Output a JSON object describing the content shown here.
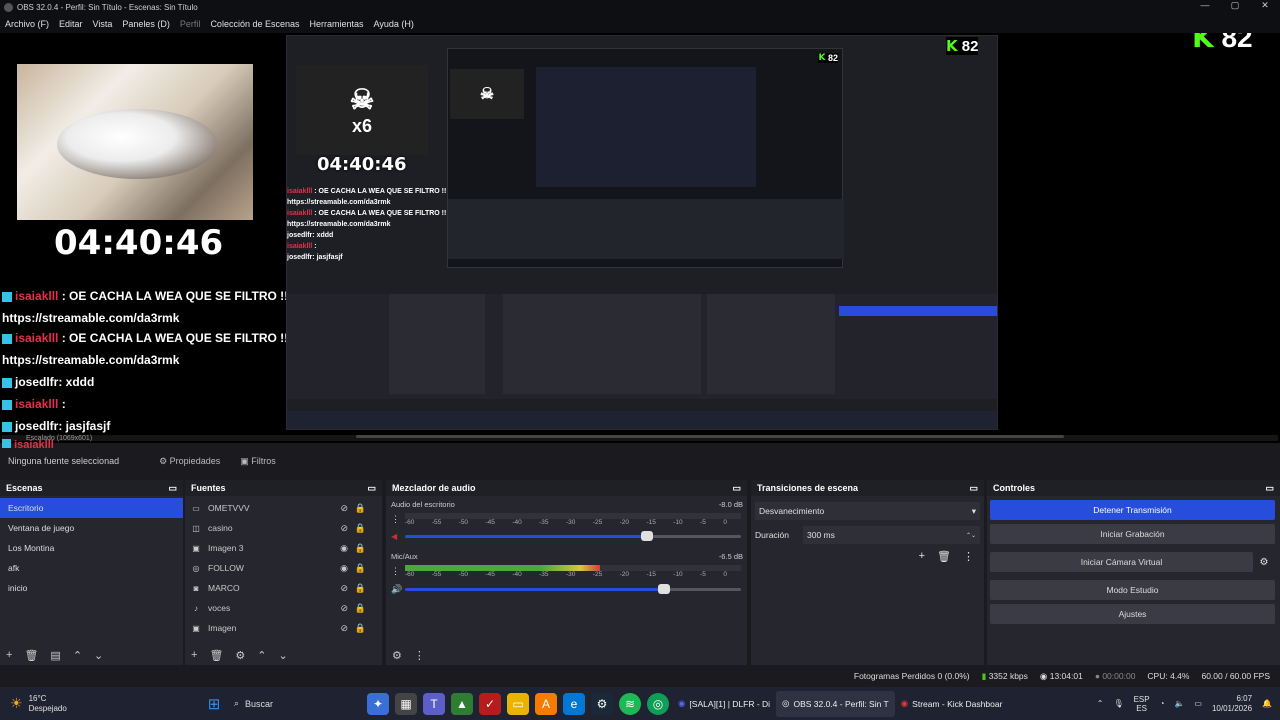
{
  "title_bar": {
    "title": "OBS 32.0.4 - Perfil: Sin Título - Escenas: Sin Título"
  },
  "menu": [
    "Archivo (F)",
    "Editar",
    "Vista",
    "Paneles (D)",
    "Perfil",
    "Colección de Escenas",
    "Herramientas",
    "Ayuda (H)"
  ],
  "preview": {
    "timer": "04:40:46",
    "kick_count": "82",
    "skull_multiplier": "x6",
    "chat": [
      {
        "user": "isaiaklll",
        "msg": ": OE CACHA LA WEA QUE SE FILTRO !!"
      },
      {
        "user": "",
        "msg": "https://streamable.com/da3rmk"
      },
      {
        "user": "isaiaklll",
        "msg": ": OE CACHA LA WEA QUE SE FILTRO !!"
      },
      {
        "user": "",
        "msg": "https://streamable.com/da3rmk"
      },
      {
        "user": "josedlfr",
        "msg": ": xddd"
      },
      {
        "user": "isaiaklll",
        "msg": ":"
      },
      {
        "user": "josedlfr",
        "msg": ": jasjfasjf"
      }
    ],
    "overlap_chat": [
      "isaiaklll",
      "isaiaklll",
      "isaiaklll",
      "isaiaklll"
    ],
    "scaled": "Escalado (1069x601)"
  },
  "context_bar": {
    "no_source": "Ninguna fuente seleccionad",
    "properties": "Propiedades",
    "filters": "Filtros"
  },
  "scenes": {
    "header": "Escenas",
    "items": [
      "Escritorio",
      "Ventana de juego",
      "Los Montina",
      "afk",
      "inicio"
    ],
    "selected": 0
  },
  "sources": {
    "header": "Fuentes",
    "items": [
      {
        "icon": "display-icon",
        "name": "OMETVVV",
        "visible": false
      },
      {
        "icon": "capture-icon",
        "name": "casino",
        "visible": false
      },
      {
        "icon": "image-icon",
        "name": "Imagen 3",
        "visible": true
      },
      {
        "icon": "globe-icon",
        "name": "FOLLOW",
        "visible": true
      },
      {
        "icon": "camera-icon",
        "name": "MARCO",
        "visible": false
      },
      {
        "icon": "mic-icon",
        "name": "voces",
        "visible": false
      },
      {
        "icon": "image-icon",
        "name": "Imagen",
        "visible": false
      }
    ]
  },
  "mixer": {
    "header": "Mezclador de audio",
    "channels": [
      {
        "name": "Audio del escritorio",
        "db": "-8.0 dB",
        "level": 0.0,
        "volume": 0.72
      },
      {
        "name": "Mic/Aux",
        "db": "-6.5 dB",
        "level": 0.58,
        "volume": 0.77
      }
    ],
    "ticks": [
      "-60",
      "-55",
      "-50",
      "-45",
      "-40",
      "-35",
      "-30",
      "-25",
      "-20",
      "-15",
      "-10",
      "-5",
      "0"
    ]
  },
  "transitions": {
    "header": "Transiciones de escena",
    "current": "Desvanecimiento",
    "duration_label": "Duración",
    "duration": "300 ms"
  },
  "controls": {
    "header": "Controles",
    "buttons": [
      "Detener Transmisión",
      "Iniciar Grabación",
      "Iniciar Cámara Virtual",
      "Modo Estudio",
      "Ajustes"
    ]
  },
  "status": {
    "dropped": "Fotogramas Perdidos 0 (0.0%)",
    "kbps": "3352 kbps",
    "live_time": "13:04:01",
    "rec_time": "00:00:00",
    "cpu": "CPU: 4.4%",
    "fps": "60.00 / 60.00 FPS"
  },
  "taskbar": {
    "weather_temp": "16°C",
    "weather_desc": "Despejado",
    "search": "Buscar",
    "tasks": [
      "[SALA][1] | DLFR - Di",
      "OBS 32.0.4 - Perfil: Sin T",
      "Stream - Kick Dashboar"
    ],
    "lang": "ESP",
    "lang2": "ES",
    "time": "6:07",
    "date": "10/01/2026"
  },
  "colors": {
    "accent": "#264ddb",
    "kick_green": "#53fc18",
    "chat_user": "#e2324a"
  }
}
